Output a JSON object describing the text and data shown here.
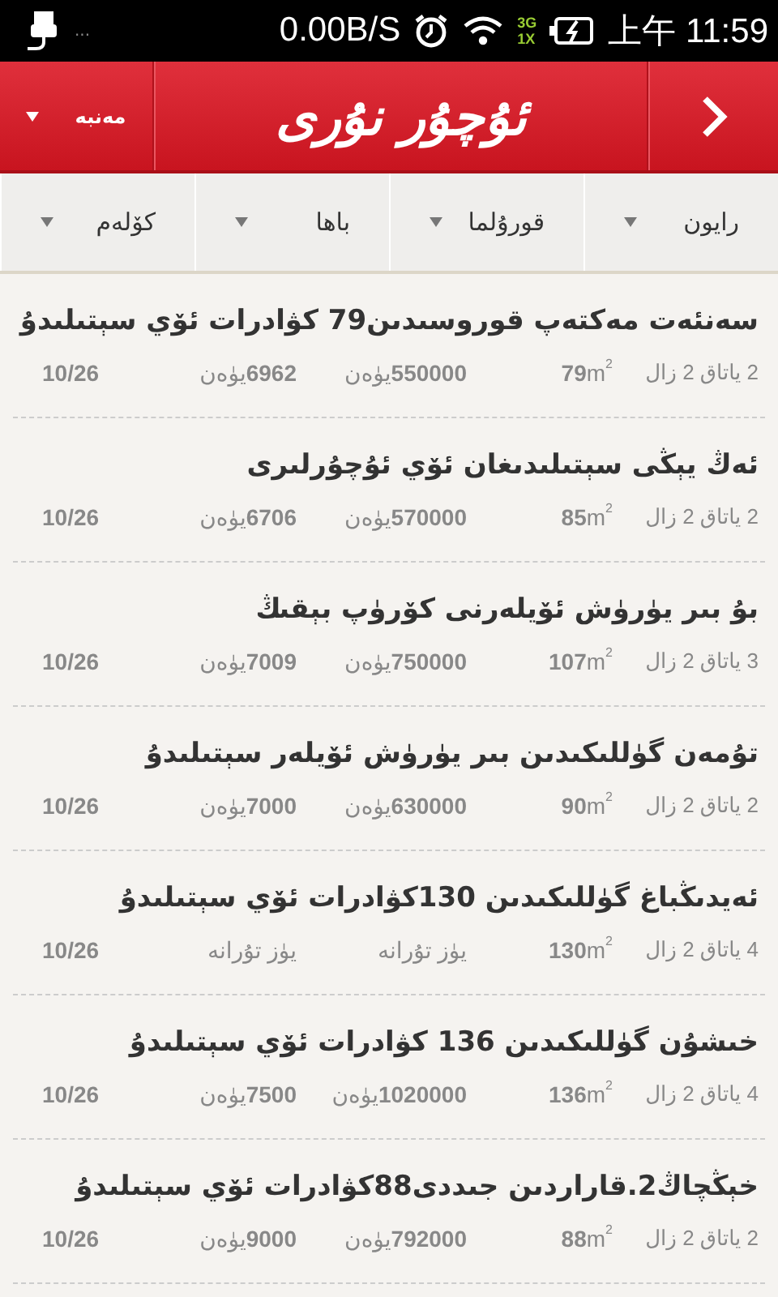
{
  "status_bar": {
    "notification": "...",
    "speed": "0.00B/S",
    "network_top": "3G",
    "network_bottom": "1X",
    "time": "上午 11:59"
  },
  "header": {
    "source_label": "مەنبە",
    "logo": "ئۇچۇر نۇرى"
  },
  "filters": [
    {
      "label": "رايون"
    },
    {
      "label": "قورۇلما"
    },
    {
      "label": "باھا"
    },
    {
      "label": "كۆلەم"
    }
  ],
  "listings": [
    {
      "title": "سەنئەت مەكتەپ قوروسىدىن79 كۋادرات ئۆي سېتىلىدۇ",
      "rooms": "2 ياتاق 2 زال",
      "area": "**79**m$^{2}$",
      "price": "**550000**يۈەن",
      "unit_price": "**6962**يۈەن",
      "date": "10/26"
    },
    {
      "title": "ئەڭ يېڭى سېتىلىدىغان ئۆي ئۇچۇرلىرى",
      "rooms": "2 ياتاق 2 زال",
      "area": "**85**m$^{2}$",
      "price": "**570000**يۈەن",
      "unit_price": "**6706**يۈەن",
      "date": "10/26"
    },
    {
      "title": "بۇ بىر يۈرۈش ئۆيلەرنى كۆرۈپ بېقىڭ",
      "rooms": "3 ياتاق 2 زال",
      "area": "**107**m$^{2}$",
      "price": "**750000**يۈەن",
      "unit_price": "**7009**يۈەن",
      "date": "10/26"
    },
    {
      "title": "تۇمەن گۈللىكىدىن بىر يۈرۈش ئۆيلەر سېتىلىدۇ",
      "rooms": "2 ياتاق 2 زال",
      "area": "**90**m$^{2}$",
      "price": "**630000**يۈەن",
      "unit_price": "**7000**يۈەن",
      "date": "10/26"
    },
    {
      "title": "ئەيدىڭباغ گۈللىكىدىن 130كۋادرات ئۆي سېتىلىدۇ",
      "rooms": "4 ياتاق 2 زال",
      "area": "**130**m$^{2}$",
      "price": "يۈز تۇرانە",
      "unit_price": "يۈز تۇرانە",
      "date": "10/26"
    },
    {
      "title": "خىشۇن گۈللىكىدىن 136 كۋادرات ئۆي سېتىلىدۇ",
      "rooms": "4 ياتاق 2 زال",
      "area": "**136**m$^{2}$",
      "price": "**1020000**يۈەن",
      "unit_price": "**7500**يۈەن",
      "date": "10/26"
    },
    {
      "title": "خېڭچاڭ2.قاراردىن جىددى88كۋادرات ئۆي سېتىلىدۇ",
      "rooms": "2 ياتاق 2 زال",
      "area": "**88**m$^{2}$",
      "price": "**792000**يۈەن",
      "unit_price": "**9000**يۈەن",
      "date": "10/26"
    }
  ]
}
